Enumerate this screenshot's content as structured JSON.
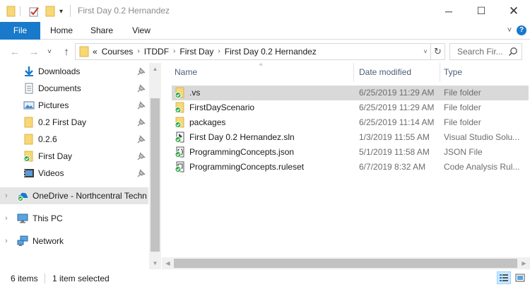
{
  "window": {
    "title": "First Day 0.2 Hernandez",
    "minimize": "─",
    "maximize": "☐",
    "close": "✕"
  },
  "ribbon": {
    "tabs": [
      "File",
      "Home",
      "Share",
      "View"
    ],
    "collapse": "˅",
    "help": "?"
  },
  "nav": {
    "back": "←",
    "forward": "→",
    "recent": "˅",
    "up": "↑"
  },
  "address": {
    "overflow": "«",
    "crumbs": [
      "Courses",
      "ITDDF",
      "First Day",
      "First Day 0.2 Hernandez"
    ],
    "separator": "›",
    "dropdown": "˅",
    "refresh": "↻"
  },
  "search": {
    "placeholder": "Search Fir..."
  },
  "sidebar": {
    "items": [
      {
        "label": "Downloads",
        "icon": "download-icon",
        "pinned": true
      },
      {
        "label": "Documents",
        "icon": "documents-icon",
        "pinned": true
      },
      {
        "label": "Pictures",
        "icon": "pictures-icon",
        "pinned": true
      },
      {
        "label": "0.2 First Day",
        "icon": "folder-icon",
        "pinned": true
      },
      {
        "label": "0.2.6",
        "icon": "folder-icon",
        "pinned": true
      },
      {
        "label": "First Day",
        "icon": "folder-synced-icon",
        "pinned": true
      },
      {
        "label": "Videos",
        "icon": "videos-icon",
        "pinned": true
      },
      {
        "label": "OneDrive - Northcentral Techn",
        "icon": "onedrive-icon",
        "pinned": false
      },
      {
        "label": "This PC",
        "icon": "this-pc-icon",
        "pinned": false
      },
      {
        "label": "Network",
        "icon": "network-icon",
        "pinned": false
      }
    ],
    "expand_glyph": "›"
  },
  "columns": {
    "name": "Name",
    "date": "Date modified",
    "type": "Type",
    "sort_glyph": "^"
  },
  "files": [
    {
      "name": ".vs",
      "date": "6/25/2019 11:29 AM",
      "type": "File folder",
      "icon": "folder-synced-icon"
    },
    {
      "name": "FirstDayScenario",
      "date": "6/25/2019 11:29 AM",
      "type": "File folder",
      "icon": "folder-synced-icon"
    },
    {
      "name": "packages",
      "date": "6/25/2019 11:14 AM",
      "type": "File folder",
      "icon": "folder-synced-icon"
    },
    {
      "name": "First Day 0.2 Hernandez.sln",
      "date": "1/3/2019 11:55 AM",
      "type": "Visual Studio Solu...",
      "icon": "solution-file-icon"
    },
    {
      "name": "ProgrammingConcepts.json",
      "date": "5/1/2019 11:58 AM",
      "type": "JSON File",
      "icon": "json-file-icon"
    },
    {
      "name": "ProgrammingConcepts.ruleset",
      "date": "6/7/2019 8:32 AM",
      "type": "Code Analysis Rul...",
      "icon": "ruleset-file-icon"
    }
  ],
  "status": {
    "item_count": "6 items",
    "selection": "1 item selected"
  },
  "colors": {
    "accent": "#1979ca",
    "folder": "#f8d775",
    "sync_green": "#28a745",
    "selected_row": "#d9d9d9"
  }
}
